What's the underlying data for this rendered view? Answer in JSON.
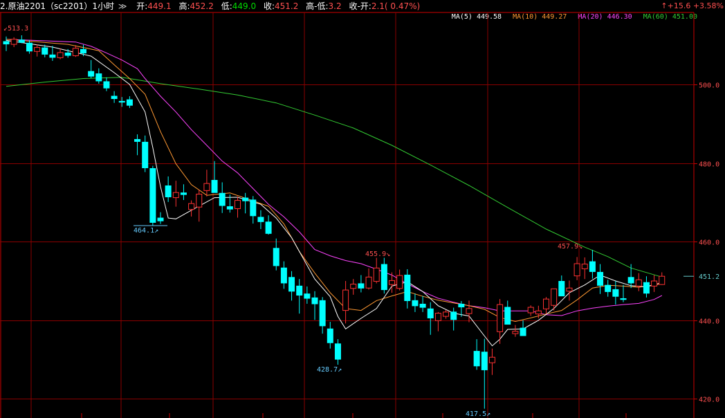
{
  "header": {
    "symbol": "2.原油2201（sc2201）1小时",
    "dropdown_icon": "double-chevron-down",
    "open_label": "开:",
    "open": "449.1",
    "high_label": "高:",
    "high": "452.2",
    "low_label": "低:",
    "low": "449.0",
    "close_label": "收:",
    "close": "451.2",
    "hl_label": "高-低:",
    "hl": "3.2",
    "co_label": "收-开:",
    "co": "2.1( 0.47%)",
    "change": "↑+15.6 +3.58%"
  },
  "ma_legend": [
    {
      "label": "MA(5)",
      "value": "449.58",
      "color": "#ffffff"
    },
    {
      "label": "MA(10)",
      "value": "449.27",
      "color": "#ff9933"
    },
    {
      "label": "MA(20)",
      "value": "446.30",
      "color": "#ff44ff"
    },
    {
      "label": "MA(60)",
      "value": "451.00",
      "color": "#33cc33"
    }
  ],
  "colors": {
    "up": "#ff3232",
    "down": "#00ffff",
    "grid": "#8b0000",
    "axis": "#cc0000",
    "ma5": "#ffffff",
    "ma10": "#ff9933",
    "ma20": "#ff44ff",
    "ma60": "#33cc33",
    "last_price": "#66cccc"
  },
  "chart_data": {
    "type": "candlestick",
    "ylim": [
      415,
      518
    ],
    "y_ticks": [
      "500.0",
      "480.0",
      "460.0",
      "440.0",
      "420.0"
    ],
    "last_price_label": "451.2",
    "annotations": [
      "513.3",
      "464.1",
      "455.9",
      "428.7",
      "457.9",
      "417.5"
    ],
    "candles": [
      [
        511.0,
        512.2,
        508.5,
        510.2
      ],
      [
        510.2,
        512.0,
        509.5,
        511.5
      ],
      [
        511.4,
        512.5,
        510.5,
        510.6
      ],
      [
        510.6,
        511.3,
        507.8,
        508.4
      ],
      [
        508.4,
        510.2,
        507.1,
        509.4
      ],
      [
        509.4,
        510.1,
        506.9,
        507.6
      ],
      [
        507.6,
        509.8,
        506.0,
        506.8
      ],
      [
        506.8,
        509.2,
        506.4,
        508.1
      ],
      [
        508.1,
        509.0,
        506.8,
        507.3
      ],
      [
        507.3,
        510.0,
        507.0,
        509.2
      ],
      [
        509.0,
        510.1,
        507.2,
        507.9
      ],
      [
        503.4,
        506.2,
        501.6,
        502.0
      ],
      [
        502.8,
        504.1,
        500.2,
        500.8
      ],
      [
        500.8,
        501.8,
        498.3,
        499.0
      ],
      [
        497.1,
        498.3,
        495.3,
        496.3
      ],
      [
        495.8,
        496.8,
        494.3,
        495.4
      ],
      [
        496.2,
        497.0,
        494.0,
        494.6
      ],
      [
        486.1,
        487.3,
        482.0,
        485.4
      ],
      [
        485.4,
        487.0,
        477.7,
        478.7
      ],
      [
        478.7,
        479.3,
        464.1,
        464.8
      ],
      [
        466.1,
        467.5,
        464.5,
        465.2
      ],
      [
        474.3,
        476.6,
        470.1,
        471.3
      ],
      [
        471.2,
        475.5,
        468.9,
        472.5
      ],
      [
        472.5,
        474.6,
        470.6,
        471.9
      ],
      [
        468.2,
        470.5,
        466.4,
        469.7
      ],
      [
        468.8,
        473.2,
        465.1,
        472.1
      ],
      [
        473.0,
        478.3,
        471.5,
        474.8
      ],
      [
        475.7,
        480.5,
        472.6,
        472.4
      ],
      [
        472.4,
        475.1,
        467.3,
        469.1
      ],
      [
        469.0,
        472.0,
        467.4,
        468.2
      ],
      [
        468.4,
        471.5,
        466.1,
        470.5
      ],
      [
        471.2,
        472.4,
        467.2,
        470.3
      ],
      [
        470.7,
        471.6,
        464.6,
        466.5
      ],
      [
        466.3,
        468.0,
        463.2,
        465.0
      ],
      [
        465.1,
        466.7,
        461.8,
        462.0
      ],
      [
        458.4,
        460.8,
        452.7,
        453.8
      ],
      [
        453.4,
        455.0,
        448.0,
        449.4
      ],
      [
        451.0,
        452.5,
        445.0,
        447.3
      ],
      [
        448.8,
        450.5,
        441.7,
        446.3
      ],
      [
        446.8,
        448.6,
        444.2,
        445.5
      ],
      [
        445.8,
        447.4,
        440.1,
        444.1
      ],
      [
        445.1,
        445.9,
        436.6,
        438.5
      ],
      [
        437.9,
        439.6,
        432.8,
        434.2
      ],
      [
        434.1,
        435.2,
        428.7,
        430.0
      ],
      [
        442.5,
        450.0,
        439.2,
        447.7
      ],
      [
        448.1,
        450.5,
        446.5,
        449.2
      ],
      [
        449.4,
        451.5,
        447.1,
        448.1
      ],
      [
        448.2,
        453.2,
        447.8,
        451.0
      ],
      [
        449.9,
        455.9,
        449.4,
        453.3
      ],
      [
        454.3,
        455.9,
        446.8,
        447.7
      ],
      [
        449.1,
        452.2,
        447.0,
        450.1
      ],
      [
        448.1,
        452.9,
        447.6,
        451.4
      ],
      [
        451.6,
        453.0,
        443.0,
        444.9
      ],
      [
        445.1,
        446.8,
        442.1,
        443.6
      ],
      [
        444.2,
        446.2,
        442.1,
        443.2
      ],
      [
        443.0,
        444.6,
        436.3,
        440.5
      ],
      [
        439.9,
        442.1,
        437.2,
        441.8
      ],
      [
        441.0,
        442.6,
        440.4,
        442.1
      ],
      [
        442.2,
        443.2,
        437.4,
        440.1
      ],
      [
        444.2,
        444.9,
        440.9,
        443.3
      ],
      [
        441.7,
        445.0,
        439.5,
        443.0
      ],
      [
        432.2,
        435.2,
        427.4,
        428.3
      ],
      [
        432.0,
        435.3,
        417.5,
        427.3
      ],
      [
        429.2,
        432.8,
        426.1,
        430.6
      ],
      [
        437.1,
        445.4,
        434.0,
        444.0
      ],
      [
        443.4,
        445.0,
        440.7,
        438.9
      ],
      [
        436.6,
        438.8,
        435.8,
        437.2
      ],
      [
        438.1,
        440.0,
        436.1,
        436.0
      ],
      [
        441.9,
        443.8,
        441.1,
        443.3
      ],
      [
        441.6,
        443.7,
        440.5,
        442.4
      ],
      [
        442.9,
        445.9,
        441.6,
        445.4
      ],
      [
        443.8,
        446.3,
        442.5,
        448.0
      ],
      [
        450.0,
        451.4,
        446.3,
        446.1
      ],
      [
        447.4,
        450.1,
        445.0,
        448.2
      ],
      [
        451.3,
        456.1,
        450.2,
        454.4
      ],
      [
        453.1,
        456.0,
        450.5,
        454.3
      ],
      [
        455.0,
        457.9,
        450.6,
        452.3
      ],
      [
        452.3,
        454.3,
        446.7,
        448.8
      ],
      [
        449.0,
        450.3,
        446.0,
        447.2
      ],
      [
        447.9,
        450.0,
        444.0,
        446.0
      ],
      [
        445.6,
        449.0,
        444.6,
        445.2
      ],
      [
        451.0,
        454.3,
        448.2,
        449.4
      ],
      [
        448.7,
        452.0,
        447.4,
        450.3
      ],
      [
        449.7,
        451.2,
        445.8,
        446.8
      ],
      [
        448.7,
        451.5,
        447.2,
        450.0
      ],
      [
        449.1,
        452.2,
        449.0,
        451.2
      ]
    ],
    "ma5": [
      [
        0,
        511.2
      ],
      [
        6,
        509.5
      ],
      [
        11,
        507.2
      ],
      [
        14,
        503
      ],
      [
        16,
        500
      ],
      [
        18,
        493
      ],
      [
        19,
        484
      ],
      [
        20,
        474
      ],
      [
        21,
        466
      ],
      [
        22,
        465.8
      ],
      [
        24,
        468
      ],
      [
        27,
        471.2
      ],
      [
        30,
        471.3
      ],
      [
        33,
        469.5
      ],
      [
        35,
        466
      ],
      [
        37,
        461
      ],
      [
        40,
        450.5
      ],
      [
        42,
        446
      ],
      [
        43,
        441
      ],
      [
        44,
        437.8
      ],
      [
        46,
        440.5
      ],
      [
        48,
        443
      ],
      [
        50,
        448.7
      ],
      [
        52,
        449.8
      ],
      [
        54,
        447.3
      ],
      [
        56,
        443.7
      ],
      [
        58,
        441.8
      ],
      [
        60,
        441.1
      ],
      [
        62,
        436
      ],
      [
        63,
        433.5
      ],
      [
        64,
        435.2
      ],
      [
        65,
        437.7
      ],
      [
        67,
        437.8
      ],
      [
        69,
        440
      ],
      [
        71,
        443
      ],
      [
        73,
        447
      ],
      [
        75,
        449
      ],
      [
        77,
        451.5
      ],
      [
        79,
        450
      ],
      [
        81,
        448.8
      ],
      [
        83,
        448.5
      ],
      [
        85,
        449.6
      ]
    ],
    "ma10": [
      [
        0,
        511.5
      ],
      [
        8,
        510.2
      ],
      [
        12,
        508.6
      ],
      [
        14,
        505
      ],
      [
        16,
        501.5
      ],
      [
        18,
        497.5
      ],
      [
        20,
        488
      ],
      [
        22,
        479.8
      ],
      [
        24,
        474.5
      ],
      [
        26,
        471.8
      ],
      [
        29,
        472.4
      ],
      [
        32,
        470.4
      ],
      [
        34,
        469
      ],
      [
        36,
        464.5
      ],
      [
        38,
        457.5
      ],
      [
        40,
        452
      ],
      [
        42,
        447
      ],
      [
        44,
        443
      ],
      [
        46,
        442.5
      ],
      [
        48,
        445
      ],
      [
        50,
        446.2
      ],
      [
        52,
        447.3
      ],
      [
        54,
        446.1
      ],
      [
        56,
        445.1
      ],
      [
        58,
        444.4
      ],
      [
        60,
        443.7
      ],
      [
        62,
        442.8
      ],
      [
        64,
        440.7
      ],
      [
        66,
        439.7
      ],
      [
        68,
        440.6
      ],
      [
        70,
        441.6
      ],
      [
        72,
        442.5
      ],
      [
        74,
        445.2
      ],
      [
        76,
        448.2
      ],
      [
        78,
        448.9
      ],
      [
        80,
        448.7
      ],
      [
        82,
        448.4
      ],
      [
        85,
        449.3
      ]
    ],
    "ma20": [
      [
        0,
        511.5
      ],
      [
        9,
        510.8
      ],
      [
        11,
        509.7
      ],
      [
        13,
        508
      ],
      [
        15,
        506.2
      ],
      [
        17,
        504
      ],
      [
        18,
        501.5
      ],
      [
        20,
        497
      ],
      [
        22,
        493
      ],
      [
        24,
        488.5
      ],
      [
        26,
        484.5
      ],
      [
        28,
        480.5
      ],
      [
        30,
        477.5
      ],
      [
        32,
        473.5
      ],
      [
        34,
        469.5
      ],
      [
        36,
        466.3
      ],
      [
        38,
        462.5
      ],
      [
        40,
        458
      ],
      [
        42,
        456.4
      ],
      [
        44,
        455.2
      ],
      [
        46,
        454.4
      ],
      [
        48,
        453
      ],
      [
        50,
        451.5
      ],
      [
        52,
        449.3
      ],
      [
        54,
        447.3
      ],
      [
        56,
        445.6
      ],
      [
        58,
        444.6
      ],
      [
        60,
        443.7
      ],
      [
        62,
        443.2
      ],
      [
        64,
        442.4
      ],
      [
        66,
        442.4
      ],
      [
        68,
        442.4
      ],
      [
        70,
        441.4
      ],
      [
        72,
        441.2
      ],
      [
        74,
        442.4
      ],
      [
        76,
        443.1
      ],
      [
        78,
        443.6
      ],
      [
        80,
        444
      ],
      [
        82,
        444.3
      ],
      [
        84,
        445.3
      ],
      [
        85,
        446.3
      ]
    ],
    "ma60": [
      [
        0,
        499.5
      ],
      [
        5,
        500.6
      ],
      [
        10,
        501.5
      ],
      [
        15,
        501.8
      ],
      [
        20,
        500.2
      ],
      [
        25,
        498.8
      ],
      [
        30,
        497.3
      ],
      [
        35,
        495.3
      ],
      [
        40,
        492.2
      ],
      [
        45,
        488.9
      ],
      [
        50,
        484.5
      ],
      [
        55,
        479.5
      ],
      [
        60,
        474.3
      ],
      [
        65,
        468.7
      ],
      [
        70,
        463.2
      ],
      [
        75,
        458.6
      ],
      [
        78,
        456.2
      ],
      [
        81,
        453.3
      ],
      [
        85,
        451
      ]
    ]
  }
}
